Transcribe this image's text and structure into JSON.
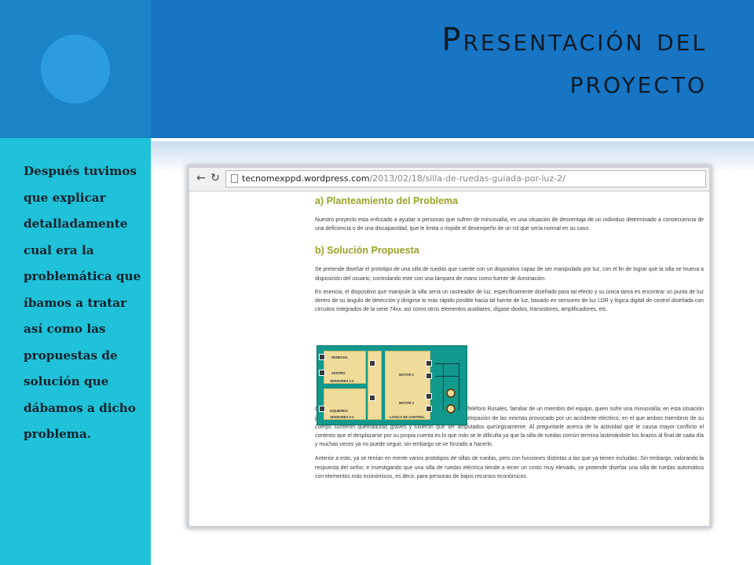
{
  "slide": {
    "title_line1": "Presentación del",
    "title_line2": "proyecto",
    "side_text": "Después tuvimos que explicar detalladamente cual era la problemática que íbamos a tratar así como las propuestas de solución que dábamos a dicho problema.",
    "colors": {
      "header": "#1775c4",
      "left_top": "#1a84c7",
      "circle": "#2d9be0",
      "left_side": "#1fc2d8"
    }
  },
  "browser": {
    "back_icon": "arrow-left-icon",
    "reload_icon": "reload-icon",
    "page_icon": "page-icon",
    "url_host": "tecnomexppd.wordpress.com",
    "url_path": "/2013/02/18/silla-de-ruedas-guiada-por-luz-2/"
  },
  "article": {
    "section_a_title": "a) Planteamiento del Problema",
    "section_a_text": "Nuestro proyecto esta enfocado a ayudar a personas que sufren de minusvalía, es una situación de desventaja de un individuo determinado a consecuencia de una deficiencia o de una discapacidad, que le limita o impide el desempeño de un rol que sería normal en su caso.",
    "section_b_title": "b) Solución Propuesta",
    "section_b_text1": "Se pretende diseñar el prototipo de una silla de ruedas que cuente con un dispositivo capaz de ser manipulado por luz, con el fin de lograr que la silla se mueva a disposición del usuario, controlando este con una lámpara de mano como fuente de iluminación.",
    "section_b_text2": "En esencia, el dispositivo que manipule la silla sería un rastreador de luz, específicamente diseñado para tal efecto y su única tarea es encontrar un punto de luz dentro de su ángulo de detección y dirigirse lo más rápido posible hacia tal fuente de luz, basado en sensores de luz LDR y lógica digital de control diseñada con circuitos integrados de la serie 74xx, así como otros elementos auxiliares, dígase diodos, transistores, amplificadores, etc.",
    "circuit": {
      "label_sensores_12": "SENSORES 1-2",
      "label_sensores_23": "SENSORES 2-3",
      "label_logica": "LOGICA DE CONTROL",
      "label_derecha": "DERECHA",
      "label_centro": "CENTRO",
      "label_izquierda": "IZQUIERDA",
      "label_motor_1": "MOTOR 1",
      "label_motor_2": "MOTOR 2"
    },
    "section_b_text3": "Considerando una entrevista realizada al señor Marco Antonio Teléforo Rosales, familiar de un miembro del equipo, quien sufre una minusvalía; en esta situación particular, la falta de extremidades inferiores a causa de una extirpación de las mismas provocado por un accidente eléctrico, en el que ambos miembros de su cuerpo sufrieron quemaduras graves y tuvieron que ser amputados quirúrgicamente. Al preguntarle acerca de la actividad que le causa mayor conflicto el contesto que el desplazarse por su propia cuenta es lo que más se le dificulta ya que la silla de ruedas común termina lastimándole los brazos al final de cada día y muchas veces ya no puede seguir, sin embargo se ve forzado a hacerlo.",
    "section_b_text4": "Anterior a esto, ya se tenían en mente varios prototipos de sillas de ruedas, pero con funciones distintas a las que ya tienen incluidas. Sin embargo, valorando la respuesta del señor, e investigando que una silla de ruedas eléctrica tiende a tener un costo muy elevado, se pretende diseñar una silla de ruedas automática con elementos más económicos, es decir, para personas de bajos recursos económicos."
  }
}
